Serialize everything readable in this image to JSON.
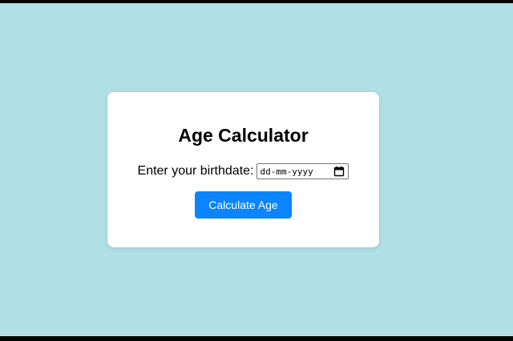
{
  "app": {
    "title": "Age Calculator"
  },
  "form": {
    "birthdate_label": "Enter your birthdate:",
    "date_placeholder": "dd-mm-yyyy",
    "calendar_icon": "calendar-icon",
    "submit_label": "Calculate Age"
  },
  "colors": {
    "page_background": "#b0dfe5",
    "card_background": "#ffffff",
    "button_background": "#0a84ff",
    "button_text": "#ffffff"
  }
}
